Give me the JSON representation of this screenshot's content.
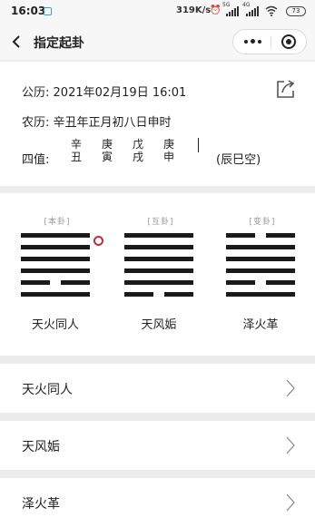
{
  "status_bar": {
    "time": "16:03",
    "net_speed": "319K/s",
    "network_1": "5G",
    "network_2": "4G",
    "battery": "73"
  },
  "nav": {
    "title": "指定起卦"
  },
  "info": {
    "gongli_label": "公历:",
    "gongli_value": "2021年02月19日 16:01",
    "nongli_label": "农历:",
    "nongli_value": "辛丑年正月初八日申时",
    "sizhi_label": "四值:",
    "pillars": [
      {
        "stem": "辛",
        "branch": "丑"
      },
      {
        "stem": "庚",
        "branch": "寅"
      },
      {
        "stem": "戊",
        "branch": "戌"
      },
      {
        "stem": "庚",
        "branch": "申"
      }
    ],
    "void_text": "(辰巳空)"
  },
  "hexagrams": [
    {
      "tag": "[本卦]",
      "name": "天火同人",
      "lines_top_to_bottom": [
        "yang",
        "yang",
        "yang",
        "yang",
        "yin",
        "yang"
      ],
      "moving_line": "top"
    },
    {
      "tag": "[互卦]",
      "name": "天风姤",
      "lines_top_to_bottom": [
        "yang",
        "yang",
        "yang",
        "yang",
        "yang",
        "yin"
      ]
    },
    {
      "tag": "[变卦]",
      "name": "泽火革",
      "lines_top_to_bottom": [
        "yin",
        "yang",
        "yang",
        "yang",
        "yin",
        "yang"
      ]
    }
  ],
  "list": [
    {
      "label": "天火同人"
    },
    {
      "label": "天风姤"
    },
    {
      "label": "泽火革"
    }
  ],
  "colors": {
    "moving_mark": "#c8283a",
    "page_background": "#ececec"
  }
}
